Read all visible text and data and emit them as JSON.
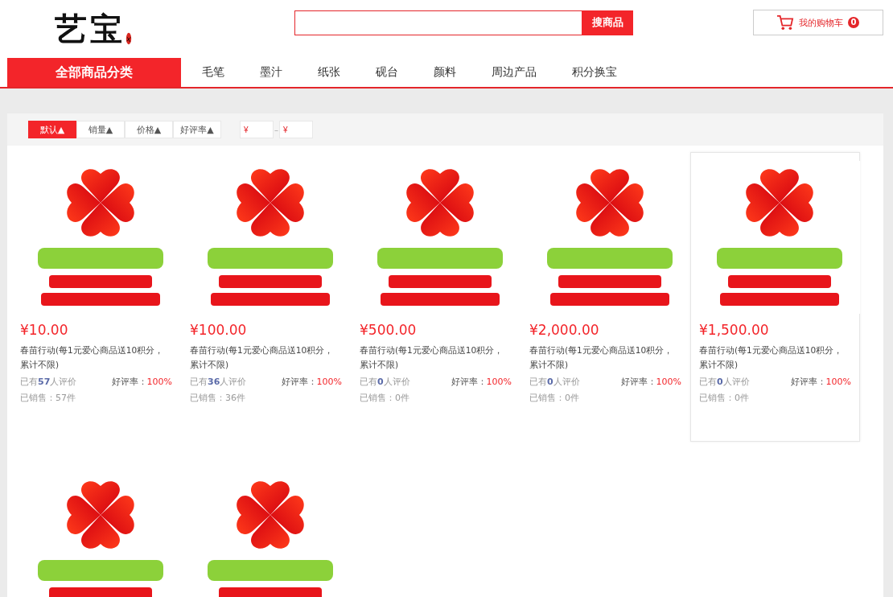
{
  "logo": {
    "text": "艺宝"
  },
  "search": {
    "button": "搜商品"
  },
  "cart": {
    "label": "我的购物车",
    "count": "0"
  },
  "category_button": "全部商品分类",
  "nav": [
    {
      "label": "毛笔"
    },
    {
      "label": "墨汁"
    },
    {
      "label": "纸张"
    },
    {
      "label": "砚台"
    },
    {
      "label": "颜料"
    },
    {
      "label": "周边产品"
    },
    {
      "label": "积分换宝"
    }
  ],
  "sort_tabs": [
    {
      "label": "默认",
      "arrow": "▲",
      "selected": true
    },
    {
      "label": "销量",
      "arrow": "▲",
      "selected": false
    },
    {
      "label": "价格",
      "arrow": "▲",
      "selected": false
    },
    {
      "label": "好评率",
      "arrow": "▲",
      "selected": false
    }
  ],
  "price_filter": {
    "min_placeholder": "¥",
    "separator": "–",
    "max_placeholder": "¥"
  },
  "products": [
    {
      "image": {
        "kind": "picture"
      },
      "price": "¥10.00",
      "title": "春苗行动(每1元爱心商品送10积分，累计不限)",
      "reviews_prefix": "已有",
      "reviews_count": "57",
      "reviews_suffix": "人评价",
      "rating_label": "好评率：",
      "rating": "100%",
      "sold": "已销售：57件",
      "highlighted": false
    },
    {
      "image": {
        "kind": "picture"
      },
      "price": "¥100.00",
      "title": "春苗行动(每1元爱心商品送10积分，累计不限)",
      "reviews_prefix": "已有",
      "reviews_count": "36",
      "reviews_suffix": "人评价",
      "rating_label": "好评率：",
      "rating": "100%",
      "sold": "已销售：36件",
      "highlighted": false
    },
    {
      "image": {
        "kind": "picture"
      },
      "price": "¥500.00",
      "title": "春苗行动(每1元爱心商品送10积分，累计不限)",
      "reviews_prefix": "已有",
      "reviews_count": "0",
      "reviews_suffix": "人评价",
      "rating_label": "好评率：",
      "rating": "100%",
      "sold": "已销售：0件",
      "highlighted": false
    },
    {
      "image": {
        "kind": "picture"
      },
      "price": "¥2,000.00",
      "title": "春苗行动(每1元爱心商品送10积分，累计不限)",
      "reviews_prefix": "已有",
      "reviews_count": "0",
      "reviews_suffix": "人评价",
      "rating_label": "好评率：",
      "rating": "100%",
      "sold": "已销售：0件",
      "highlighted": false
    },
    {
      "image": {
        "kind": "picture"
      },
      "price": "¥1,500.00",
      "title": "春苗行动(每1元爱心商品送10积分，累计不限)",
      "reviews_prefix": "已有",
      "reviews_count": "0",
      "reviews_suffix": "人评价",
      "rating_label": "好评率：",
      "rating": "100%",
      "sold": "已销售：0件",
      "highlighted": true
    },
    {
      "image": {
        "kind": "picture"
      }
    },
    {
      "image": {
        "kind": "picture"
      }
    }
  ]
}
